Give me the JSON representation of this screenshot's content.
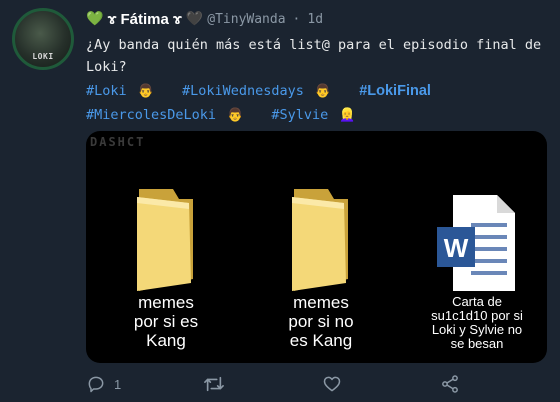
{
  "tweet": {
    "display_name": "Fátima",
    "name_prefix_emoji": "💚",
    "name_symbol_left": "ɤ",
    "name_symbol_right": "ɤ",
    "name_suffix_emoji": "🖤",
    "handle": "@TinyWanda",
    "separator": "·",
    "time": "1d",
    "text": "¿Ay banda quién más está list@ para el episodio final de Loki?",
    "avatar_text": "LOKI",
    "hashtags_row1": [
      {
        "text": "#Loki",
        "emoji": "👨"
      },
      {
        "text": "#LokiWednesdays",
        "emoji": "👨"
      },
      {
        "text": "#LokiFinal",
        "emoji": ""
      }
    ],
    "hashtags_row2": [
      {
        "text": "#MiercolesDeLoki",
        "emoji": "👨"
      },
      {
        "text": "#Sylvie",
        "emoji": "👱‍♀️"
      }
    ]
  },
  "media": {
    "watermark": "DASHCT",
    "items": [
      {
        "label": "memes\npor si es\nKang",
        "icon": "folder-icon"
      },
      {
        "label": "memes\npor si no\nes Kang",
        "icon": "folder-icon"
      },
      {
        "label": "Carta de\nsu1c1d10 por si\nLoki y Sylvie no\nse besan",
        "icon": "word-document-icon",
        "icon_letter": "W"
      }
    ]
  },
  "actions": {
    "reply_count": "1",
    "retweet_count": "",
    "like_count": "",
    "icons": [
      "reply-icon",
      "retweet-icon",
      "like-icon",
      "share-icon"
    ]
  },
  "colors": {
    "background": "#1b2430",
    "hashtag": "#4a99e9",
    "muted": "#8b98a5",
    "folder": "#f1d06a",
    "word_blue": "#2b5797"
  }
}
